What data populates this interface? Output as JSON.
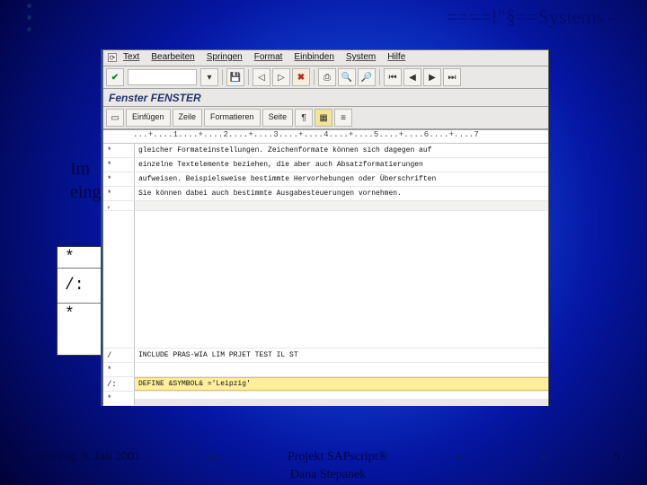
{
  "header_text": "====!\"§==Systems =",
  "body_text": "Im\neing",
  "sap": {
    "menus": [
      "Text",
      "Bearbeiten",
      "Springen",
      "Format",
      "Einbinden",
      "System",
      "Hilfe"
    ],
    "window_title": "Fenster FENSTER",
    "toolbar2": {
      "insert": "Einfügen",
      "line": "Zeile",
      "format": "Formatieren",
      "page": "Seite"
    },
    "ruler": "...+....1....+....2....+....3....+....4....+....5....+....6....+....7",
    "rows": [
      {
        "m": "*",
        "c": "gleicher Formateinstellungen. Zeichenformate können sich dagegen auf"
      },
      {
        "m": "*",
        "c": "einzelne Textelemente beziehen, die aber auch Absatzformatierungen"
      },
      {
        "m": "*",
        "c": "aufweisen. Beispielsweise bestimmte Hervorhebungen oder Überschriften"
      },
      {
        "m": "*",
        "c": "Sie können dabei auch bestimmte Ausgabesteuerungen vornehmen."
      },
      {
        "m": "/",
        "c": "INCLUDE PRAS-WIA LIM PRJET TEST IL ST"
      },
      {
        "m": "*",
        "c": ""
      },
      {
        "m": "/:",
        "c": "DEFINE &SYMBOL& ='Leipzig'",
        "hl": true
      },
      {
        "m": "*",
        "c": ""
      }
    ]
  },
  "zoom": {
    "rows": [
      {
        "m": "*",
        "c": "",
        "h": "small"
      },
      {
        "m": "/:",
        "c": "DEFINE &SYMBOL& ='Leipzig'",
        "h": "big",
        "hl": true
      },
      {
        "m": "*",
        "c": "",
        "h": "small"
      }
    ]
  },
  "footer": {
    "date": "Montag, 9. Juli 2001",
    "project": "Projekt SAPscript®",
    "author": "Dana Stepanek",
    "pagenum": "5"
  }
}
